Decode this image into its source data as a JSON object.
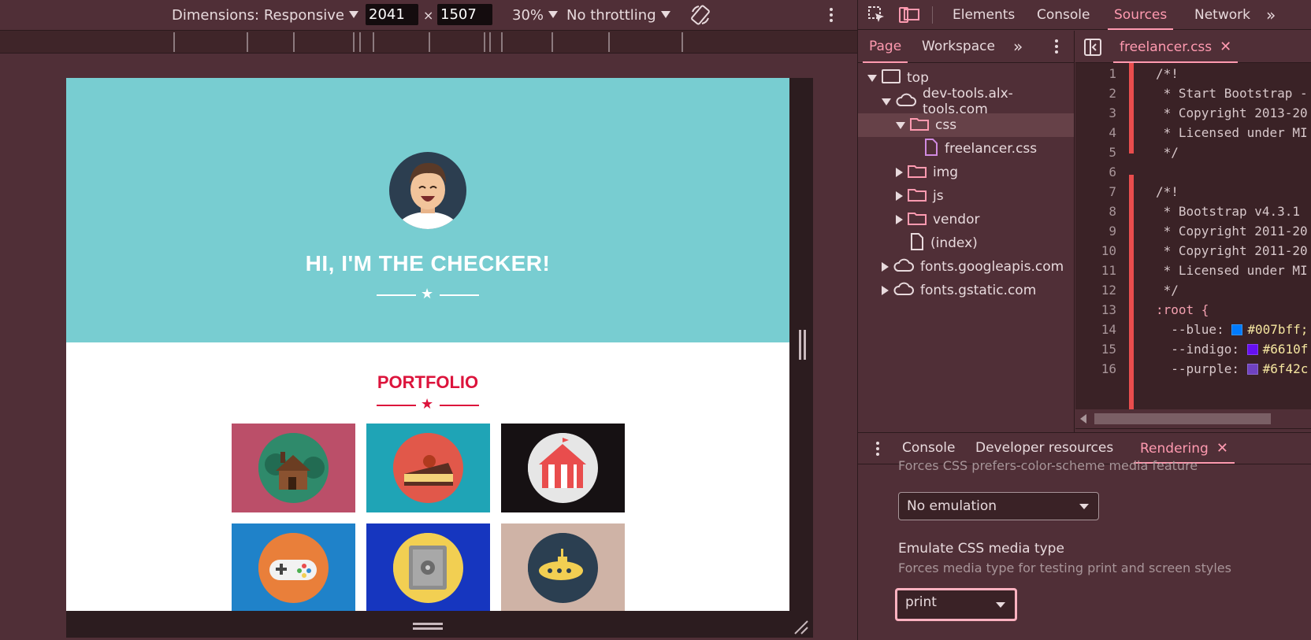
{
  "device_toolbar": {
    "dimensions_label": "Dimensions: Responsive",
    "width": "2041",
    "separator": "×",
    "height": "1507",
    "zoom": "30%",
    "throttling": "No throttling",
    "rotate_icon": "rotate-icon",
    "more_icon": "kebab-menu-icon"
  },
  "viewport": {
    "hero_title": "HI, I'M THE CHECKER!",
    "section_title": "PORTFOLIO",
    "star": "★",
    "tiles": [
      {
        "name": "cabin",
        "bg": "#bb4f69",
        "circle": "#2f8a6b"
      },
      {
        "name": "cake",
        "bg": "#1fa4b6",
        "circle": "#e1584a"
      },
      {
        "name": "circus",
        "bg": "#161113",
        "circle": "#e6e6e6"
      },
      {
        "name": "game",
        "bg": "#1f82c9",
        "circle": "#e97f3a"
      },
      {
        "name": "safe",
        "bg": "#1636bf",
        "circle": "#f2cf52"
      },
      {
        "name": "submarine",
        "bg": "#cfb3a6",
        "circle": "#2b3f51"
      }
    ],
    "colors": {
      "masthead": "#78cdd1",
      "accent": "#dc143c"
    }
  },
  "devtools": {
    "tabs": [
      "Elements",
      "Console",
      "Sources",
      "Network"
    ],
    "active_tab": "Sources",
    "more_tabs_icon": "chevron-double-right-icon",
    "inspect_icon": "inspect-element-icon",
    "device_icon": "device-toggle-icon",
    "navigator": {
      "tabs": [
        "Page",
        "Workspace"
      ],
      "active_tab": "Page",
      "tree": [
        {
          "label": "top",
          "icon": "frame-icon",
          "expanded": true
        },
        {
          "label": "dev-tools.alx-tools.com",
          "icon": "cloud-icon",
          "expanded": true
        },
        {
          "label": "css",
          "icon": "folder-icon",
          "expanded": true,
          "selected": true
        },
        {
          "label": "freelancer.css",
          "icon": "file-icon"
        },
        {
          "label": "img",
          "icon": "folder-icon",
          "expanded": false
        },
        {
          "label": "js",
          "icon": "folder-icon",
          "expanded": false
        },
        {
          "label": "vendor",
          "icon": "folder-icon",
          "expanded": false
        },
        {
          "label": "(index)",
          "icon": "file-icon"
        },
        {
          "label": "fonts.googleapis.com",
          "icon": "cloud-icon",
          "expanded": false
        },
        {
          "label": "fonts.gstatic.com",
          "icon": "cloud-icon",
          "expanded": false
        }
      ]
    },
    "editor": {
      "file_tab": "freelancer.css",
      "lines": [
        {
          "n": "1",
          "text": "/*!"
        },
        {
          "n": "2",
          "text": " * Start Bootstrap -"
        },
        {
          "n": "3",
          "text": " * Copyright 2013-20"
        },
        {
          "n": "4",
          "text": " * Licensed under MI"
        },
        {
          "n": "5",
          "text": " */"
        },
        {
          "n": "6",
          "text": ""
        },
        {
          "n": "7",
          "text": "/*!"
        },
        {
          "n": "8",
          "text": " * Bootstrap v4.3.1"
        },
        {
          "n": "9",
          "text": " * Copyright 2011-20"
        },
        {
          "n": "10",
          "text": " * Copyright 2011-20"
        },
        {
          "n": "11",
          "text": " * Licensed under MI"
        },
        {
          "n": "12",
          "text": " */"
        },
        {
          "n": "13",
          "text": ":root {"
        },
        {
          "n": "14",
          "text": "  --blue: ",
          "value": "#007bff;",
          "swatch": "#007bff"
        },
        {
          "n": "15",
          "text": "  --indigo: ",
          "value": "#6610f",
          "swatch": "#6610f2"
        },
        {
          "n": "16",
          "text": "  --purple: ",
          "value": "#6f42c",
          "swatch": "#6f42c1"
        }
      ],
      "format_icon": "pretty-print-icon"
    },
    "drawer": {
      "tabs": [
        "Console",
        "Developer resources",
        "Rendering"
      ],
      "active_tab": "Rendering",
      "truncated_text": "Forces CSS prefers-color-scheme media feature",
      "prefers_color_scheme_value": "No emulation",
      "media_type_label": "Emulate CSS media type",
      "media_type_desc": "Forces media type for testing print and screen styles",
      "media_type_value": "print"
    }
  }
}
